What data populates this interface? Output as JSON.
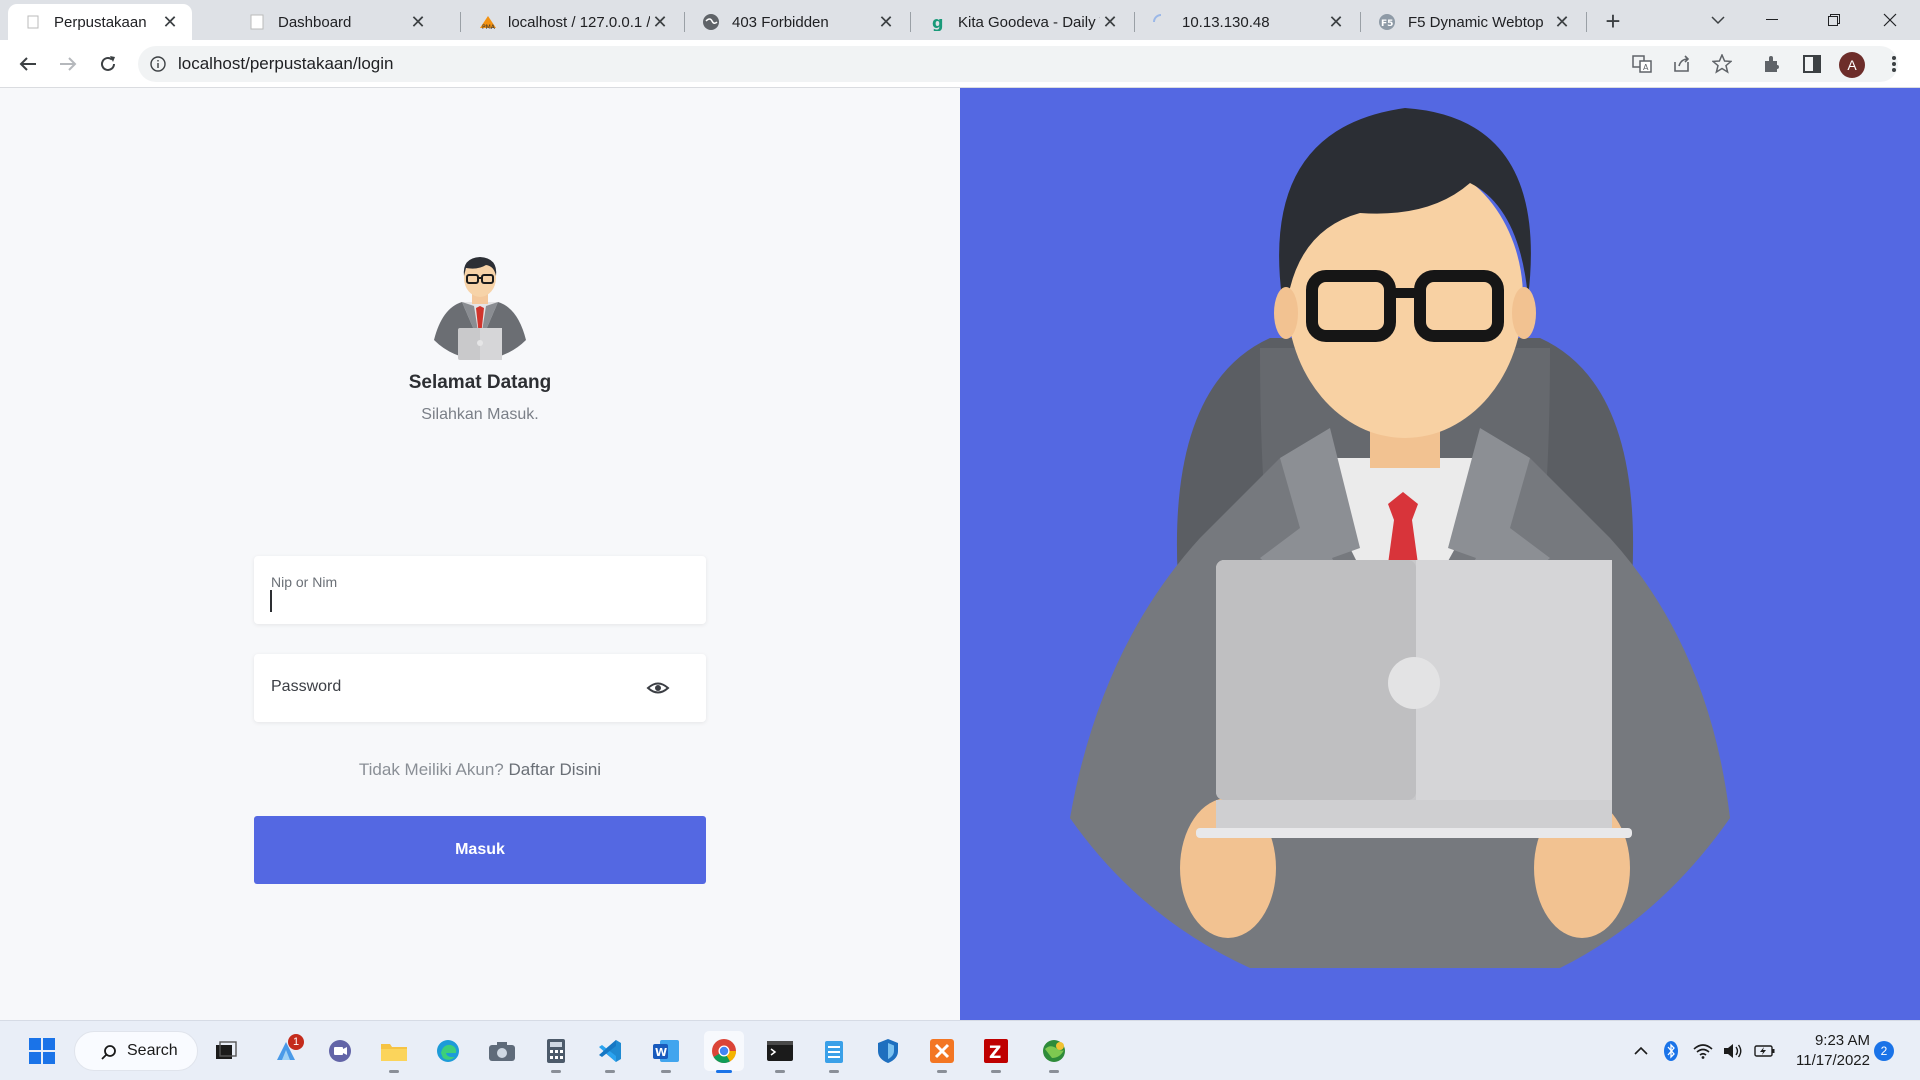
{
  "browser": {
    "tabs": [
      {
        "title": "Perpustakaan",
        "icon": "page-icon",
        "active": true
      },
      {
        "title": "Dashboard",
        "icon": "page-icon",
        "active": false
      },
      {
        "title": "localhost / 127.0.0.1 /",
        "icon": "phpmyadmin-icon",
        "active": false
      },
      {
        "title": "403 Forbidden",
        "icon": "globe-icon",
        "active": false
      },
      {
        "title": "Kita Goodeva - Daily T",
        "icon": "goodeva-icon",
        "active": false
      },
      {
        "title": "10.13.130.48",
        "icon": "loading-spinner-icon",
        "active": false
      },
      {
        "title": "F5 Dynamic Webtop",
        "icon": "f5-icon",
        "active": false
      }
    ],
    "close_glyph": "✕",
    "new_tab_glyph": "+",
    "url": "localhost/perpustakaan/login",
    "profile_initial": "A"
  },
  "login": {
    "welcome": "Selamat Datang",
    "subtitle": "Silahkan Masuk.",
    "nip_label": "Nip or Nim",
    "password_placeholder": "Password",
    "signup_prefix": "Tidak Meiliki Akun?",
    "signup_link": "Daftar Disini",
    "submit_label": "Masuk",
    "accent_color": "#5468e2"
  },
  "taskbar": {
    "search_label": "Search",
    "apps": [
      "windows-start-icon",
      "task-view-icon",
      "copilot-icon",
      "teams-chat-icon",
      "file-explorer-icon",
      "edge-icon",
      "camera-icon",
      "calculator-icon",
      "vscode-icon",
      "word-icon",
      "chrome-icon",
      "terminal-icon",
      "notepad-icon",
      "defender-icon",
      "xampp-icon",
      "filezilla-icon",
      "network-globe-icon"
    ],
    "copilot_badge": "1",
    "time": "9:23 AM",
    "date": "11/17/2022",
    "notification_count": "2"
  }
}
